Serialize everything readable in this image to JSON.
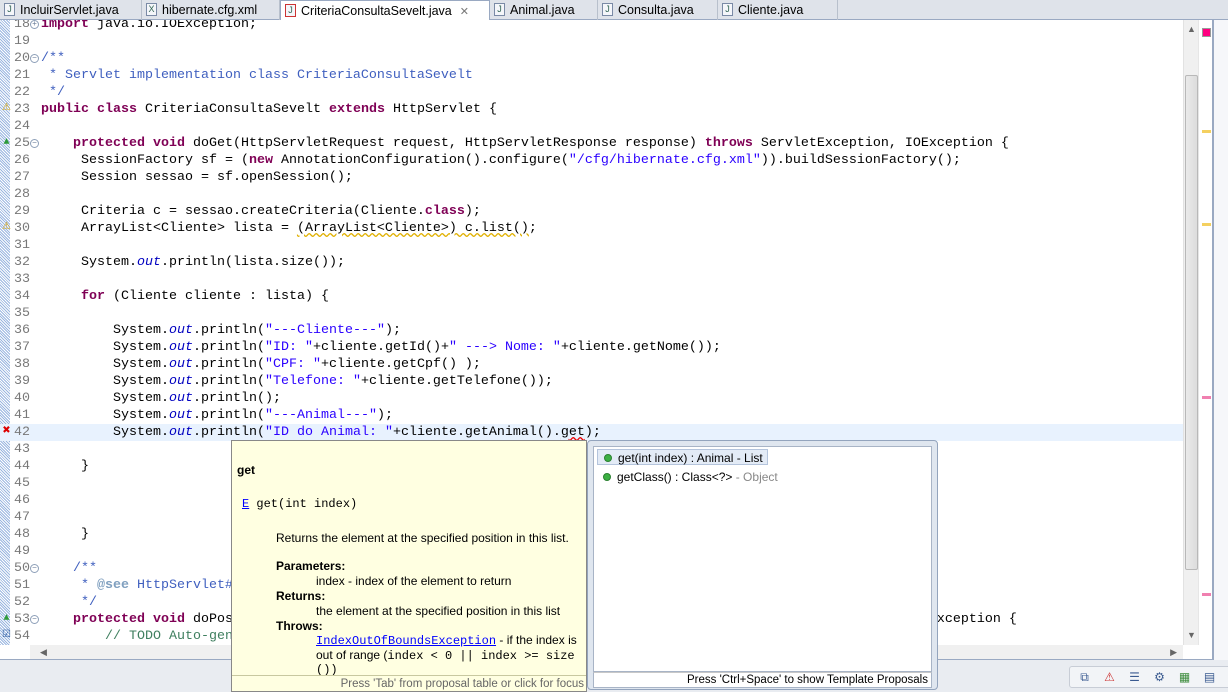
{
  "tabs": [
    {
      "label": "IncluirServlet.java",
      "icon": "java-file-icon"
    },
    {
      "label": "hibernate.cfg.xml",
      "icon": "xml-file-icon"
    },
    {
      "label": "CriteriaConsultaSevelt.java",
      "icon": "java-file-error-icon",
      "active": true
    },
    {
      "label": "Animal.java",
      "icon": "java-file-icon"
    },
    {
      "label": "Consulta.java",
      "icon": "java-file-icon"
    },
    {
      "label": "Cliente.java",
      "icon": "java-file-icon"
    }
  ],
  "code": [
    {
      "n": "18",
      "t": [
        [
          "kw",
          "import"
        ],
        [
          "",
          "java.io.IOException;"
        ]
      ],
      "fold": "+"
    },
    {
      "n": "19",
      "t": []
    },
    {
      "n": "20",
      "t": [
        [
          "jd",
          "/**"
        ]
      ],
      "fold": "-"
    },
    {
      "n": "21",
      "t": [
        [
          "jd",
          " * Servlet implementation class CriteriaConsultaSevelt"
        ]
      ]
    },
    {
      "n": "22",
      "t": [
        [
          "jd",
          " */"
        ]
      ]
    },
    {
      "n": "23",
      "t": [
        [
          "kw",
          "public"
        ],
        [
          "",
          " "
        ],
        [
          "kw",
          "class"
        ],
        [
          "",
          " CriteriaConsultaSevelt "
        ],
        [
          "kw",
          "extends"
        ],
        [
          "",
          " HttpServlet {"
        ]
      ],
      "marker": "warning"
    },
    {
      "n": "24",
      "t": []
    },
    {
      "n": "25",
      "t": [
        [
          "",
          "    "
        ],
        [
          "kw",
          "protected"
        ],
        [
          "",
          " "
        ],
        [
          "kw",
          "void"
        ],
        [
          "",
          " doGet(HttpServletRequest request, HttpServletResponse response) "
        ],
        [
          "kw",
          "throws"
        ],
        [
          "",
          " ServletException, IOException {"
        ]
      ],
      "fold": "-",
      "marker": "override"
    },
    {
      "n": "26",
      "t": [
        [
          "",
          "     SessionFactory sf = ("
        ],
        [
          "kw",
          "new"
        ],
        [
          "",
          " AnnotationConfiguration().configure("
        ],
        [
          "str",
          "\"/cfg/hibernate.cfg.xml\""
        ],
        [
          "",
          "))."
        ],
        [
          "",
          "buildSessionFactory();"
        ]
      ]
    },
    {
      "n": "27",
      "t": [
        [
          "",
          "     Session sessao = sf.openSession();"
        ]
      ]
    },
    {
      "n": "28",
      "t": []
    },
    {
      "n": "29",
      "t": [
        [
          "",
          "     Criteria c = sessao.createCriteria(Cliente."
        ],
        [
          "kw",
          "class"
        ],
        [
          "",
          ");"
        ]
      ]
    },
    {
      "n": "30",
      "t": [
        [
          "",
          "     ArrayList<Cliente> lista = "
        ],
        [
          "warn",
          "(ArrayList<Cliente>) c.list()"
        ],
        [
          "",
          ";"
        ]
      ],
      "marker": "warning"
    },
    {
      "n": "31",
      "t": []
    },
    {
      "n": "32",
      "t": [
        [
          "",
          "     System."
        ],
        [
          "fld",
          "out"
        ],
        [
          "",
          ".println(lista.size());"
        ]
      ]
    },
    {
      "n": "33",
      "t": []
    },
    {
      "n": "34",
      "t": [
        [
          "",
          "     "
        ],
        [
          "kw",
          "for"
        ],
        [
          "",
          " (Cliente cliente : lista) {"
        ]
      ]
    },
    {
      "n": "35",
      "t": []
    },
    {
      "n": "36",
      "t": [
        [
          "",
          "         System."
        ],
        [
          "fld",
          "out"
        ],
        [
          "",
          ".println("
        ],
        [
          "str",
          "\"---Cliente---\""
        ],
        [
          "",
          ");"
        ]
      ]
    },
    {
      "n": "37",
      "t": [
        [
          "",
          "         System."
        ],
        [
          "fld",
          "out"
        ],
        [
          "",
          ".println("
        ],
        [
          "str",
          "\"ID: \""
        ],
        [
          "",
          "+cliente.getId()+"
        ],
        [
          "str",
          "\" ---> Nome: \""
        ],
        [
          "",
          "+cliente.getNome());"
        ]
      ]
    },
    {
      "n": "38",
      "t": [
        [
          "",
          "         System."
        ],
        [
          "fld",
          "out"
        ],
        [
          "",
          ".println("
        ],
        [
          "str",
          "\"CPF: \""
        ],
        [
          "",
          "+cliente.getCpf() );"
        ]
      ]
    },
    {
      "n": "39",
      "t": [
        [
          "",
          "         System."
        ],
        [
          "fld",
          "out"
        ],
        [
          "",
          ".println("
        ],
        [
          "str",
          "\"Telefone: \""
        ],
        [
          "",
          "+cliente.getTelefone());"
        ]
      ]
    },
    {
      "n": "40",
      "t": [
        [
          "",
          "         System."
        ],
        [
          "fld",
          "out"
        ],
        [
          "",
          ".println();"
        ]
      ]
    },
    {
      "n": "41",
      "t": [
        [
          "",
          "         System."
        ],
        [
          "fld",
          "out"
        ],
        [
          "",
          ".println("
        ],
        [
          "str",
          "\"---Animal---\""
        ],
        [
          "",
          ");"
        ]
      ]
    },
    {
      "n": "42",
      "t": [
        [
          "",
          "         System."
        ],
        [
          "fld",
          "out"
        ],
        [
          "",
          ".println("
        ],
        [
          "str",
          "\"ID do Animal: \""
        ],
        [
          "",
          "+cliente.getAnimal()."
        ],
        [
          "err",
          "get"
        ],
        [
          "",
          ");"
        ]
      ],
      "marker": "error",
      "current": true
    },
    {
      "n": "43",
      "t": []
    },
    {
      "n": "44",
      "t": [
        [
          "",
          "     }"
        ]
      ]
    },
    {
      "n": "45",
      "t": []
    },
    {
      "n": "46",
      "t": []
    },
    {
      "n": "47",
      "t": []
    },
    {
      "n": "48",
      "t": [
        [
          "",
          "     }"
        ]
      ]
    },
    {
      "n": "49",
      "t": []
    },
    {
      "n": "50",
      "t": [
        [
          "jd",
          "    /**"
        ]
      ],
      "fold": "-"
    },
    {
      "n": "51",
      "t": [
        [
          "jd",
          "     * "
        ],
        [
          "tag",
          "@see"
        ],
        [
          "jd",
          " HttpServlet#"
        ]
      ]
    },
    {
      "n": "52",
      "t": [
        [
          "jd",
          "     */"
        ]
      ]
    },
    {
      "n": "53",
      "t": [
        [
          "",
          "    "
        ],
        [
          "kw",
          "protected"
        ],
        [
          "",
          " "
        ],
        [
          "kw",
          "void"
        ],
        [
          "",
          " doPost(HttpServletRequest request, HttpServletResponse response) "
        ],
        [
          "kw",
          "throws"
        ],
        [
          "",
          " ServletException, IOException {"
        ]
      ],
      "fold": "-",
      "marker": "override"
    },
    {
      "n": "54",
      "t": [
        [
          "cmt",
          "        // TODO Auto-gen"
        ]
      ],
      "marker": "task"
    }
  ],
  "javadoc": {
    "title": "get",
    "signature_type": "E",
    "signature": " get(int index)",
    "description": "Returns the element at the specified position in this list.",
    "parameters_label": "Parameters:",
    "parameters_text": "index - index of the element to return",
    "returns_label": "Returns:",
    "returns_text": "the element at the specified position in this list",
    "throws_label": "Throws:",
    "throws_link": "IndexOutOfBoundsException",
    "throws_text1": " - if the index is",
    "throws_text2a": "out of range (",
    "throws_text2b": "index < 0 || index >= size",
    "throws_text3": "())",
    "footer": "Press 'Tab' from proposal table or click for focus"
  },
  "proposals": {
    "items": [
      {
        "label": "get(int index) : Animal - List",
        "qualifier": "",
        "selected": true
      },
      {
        "label": "getClass() : Class<?>",
        "qualifier": " - Object",
        "selected": false
      }
    ],
    "footer": "Press 'Ctrl+Space' to show Template Proposals"
  },
  "colors": {
    "keyword": "#7f0055",
    "string": "#2a00ff",
    "javadoc": "#3f5fbf",
    "comment": "#3f7f5f",
    "field": "#0000c0",
    "current_line": "#e8f2fe",
    "doc_bg": "#ffffe1"
  }
}
